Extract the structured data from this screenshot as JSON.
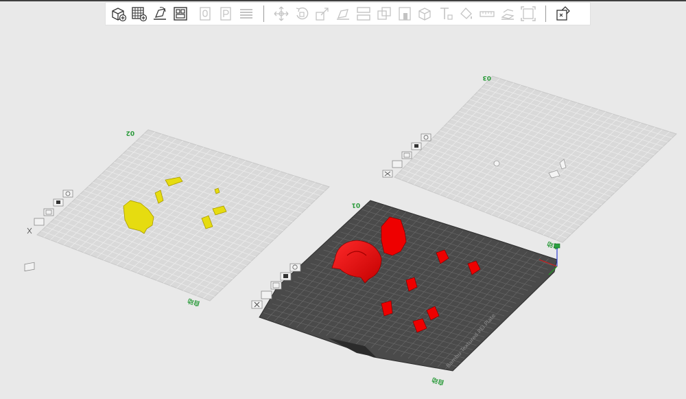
{
  "toolbar": {
    "buttons": [
      {
        "id": "add-object",
        "icon": "cube-plus-icon",
        "enabled": true
      },
      {
        "id": "add-plate",
        "icon": "grid-plus-icon",
        "enabled": true
      },
      {
        "id": "auto-orient",
        "icon": "orient-icon",
        "enabled": true
      },
      {
        "id": "arrange",
        "icon": "arrange-icon",
        "enabled": true
      },
      {
        "id": "copy",
        "icon": "copy-icon",
        "enabled": false
      },
      {
        "id": "paste",
        "icon": "paste-icon",
        "enabled": false
      },
      {
        "id": "split-layers",
        "icon": "layers-icon",
        "enabled": false
      },
      {
        "id": "move",
        "icon": "move-icon",
        "enabled": false
      },
      {
        "id": "rotate",
        "icon": "rotate-icon",
        "enabled": false
      },
      {
        "id": "scale",
        "icon": "scale-icon",
        "enabled": false
      },
      {
        "id": "lay-on-face",
        "icon": "lay-on-face-icon",
        "enabled": false
      },
      {
        "id": "cut",
        "icon": "cut-icon",
        "enabled": false
      },
      {
        "id": "boolean",
        "icon": "boolean-icon",
        "enabled": false
      },
      {
        "id": "support-paint",
        "icon": "support-paint-icon",
        "enabled": false
      },
      {
        "id": "seam-paint",
        "icon": "seam-paint-icon",
        "enabled": false
      },
      {
        "id": "text",
        "icon": "text-icon",
        "enabled": false
      },
      {
        "id": "color-paint",
        "icon": "color-paint-icon",
        "enabled": false
      },
      {
        "id": "measure",
        "icon": "measure-icon",
        "enabled": false
      },
      {
        "id": "assembly",
        "icon": "assembly-icon",
        "enabled": false
      },
      {
        "id": "fit-view",
        "icon": "fit-view-icon",
        "enabled": false
      },
      {
        "id": "variable-layer-height",
        "icon": "puzzle-icon",
        "enabled": true
      }
    ]
  },
  "plates": [
    {
      "id": "plate-02",
      "label": "02",
      "bottom_label": "自动",
      "active": false,
      "object_color": "#e6dc10"
    },
    {
      "id": "plate-03",
      "label": "03",
      "bottom_label": "自动",
      "active": false,
      "object_color": "#d8d8d8"
    },
    {
      "id": "plate-01",
      "label": "01",
      "bottom_label": "自动",
      "active": true,
      "object_color": "#ee0000",
      "plate_name": "Bambu Textured PEI Plate"
    }
  ],
  "colors": {
    "background": "#e9e9e9",
    "inactive_plate": "#d8d8d8",
    "active_plate": "#4a4a4a",
    "label_green": "#2a9a3a"
  }
}
